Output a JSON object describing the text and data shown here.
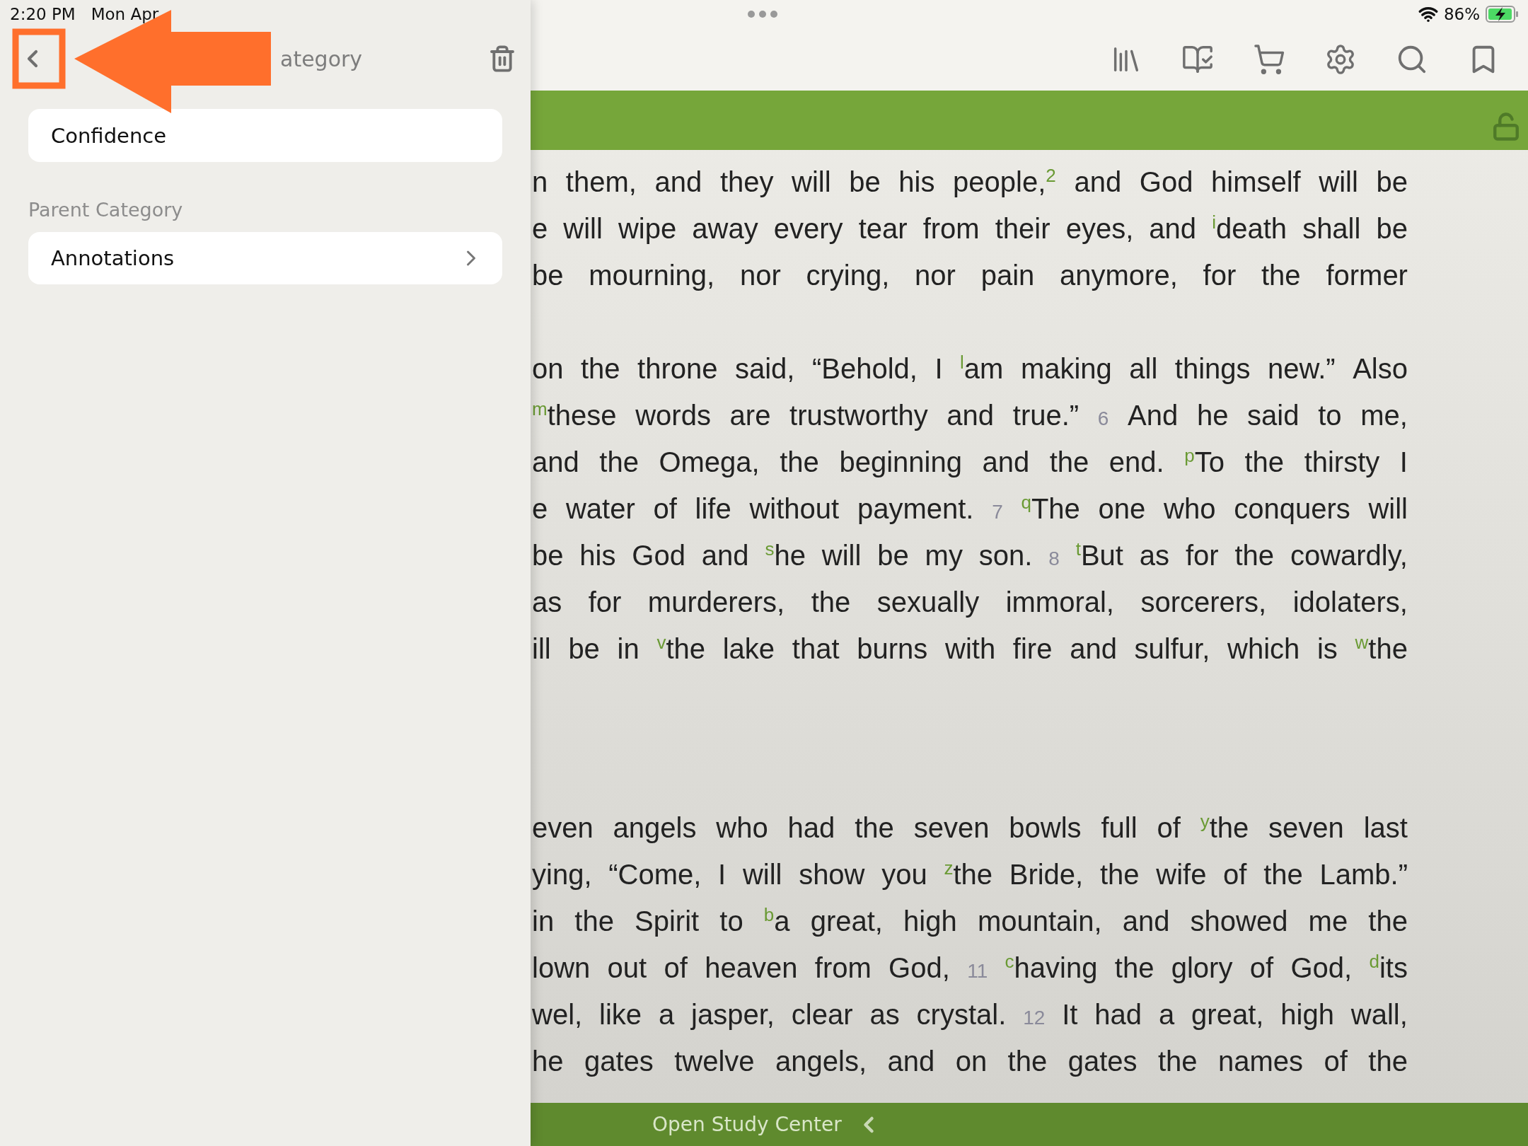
{
  "status_bar": {
    "time": "2:20 PM",
    "date": "Mon Apr",
    "battery": "86%"
  },
  "category_panel": {
    "title": "ategory",
    "name_value": "Confidence",
    "parent_label": "Parent Category",
    "parent_value": "Annotations"
  },
  "reader": {
    "paragraphs": [
      [
        [
          {
            "kind": "text",
            "text": "n them, and they will be his people,"
          },
          {
            "kind": "note",
            "text": "2"
          },
          {
            "kind": "text",
            "text": " and God himself will be"
          }
        ],
        [
          {
            "kind": "text",
            "text": "e will wipe away every tear from their eyes, and "
          },
          {
            "kind": "note",
            "text": "i"
          },
          {
            "kind": "text",
            "text": "death shall be"
          }
        ],
        [
          {
            "kind": "text",
            "text": "be mourning, nor crying, nor pain anymore, for the former"
          }
        ]
      ],
      [
        [
          {
            "kind": "text",
            "text": "on the throne said, “Behold, I "
          },
          {
            "kind": "note",
            "text": "l"
          },
          {
            "kind": "text",
            "text": "am making all things new.” Also"
          }
        ],
        [
          {
            "kind": "note",
            "text": "m"
          },
          {
            "kind": "text",
            "text": "these words are trustworthy and true.” "
          },
          {
            "kind": "verse",
            "text": "6"
          },
          {
            "kind": "text",
            "text": " And he said to me,"
          }
        ],
        [
          {
            "kind": "text",
            "text": "and the Omega, the beginning and the end. "
          },
          {
            "kind": "note",
            "text": "p"
          },
          {
            "kind": "text",
            "text": "To the thirsty I"
          }
        ],
        [
          {
            "kind": "text",
            "text": "e water of life without payment. "
          },
          {
            "kind": "verse",
            "text": "7"
          },
          {
            "kind": "note",
            "text": "q"
          },
          {
            "kind": "text",
            "text": "The one who conquers will"
          }
        ],
        [
          {
            "kind": "text",
            "text": "be his God and "
          },
          {
            "kind": "note",
            "text": "s"
          },
          {
            "kind": "text",
            "text": "he will be my son. "
          },
          {
            "kind": "verse",
            "text": "8"
          },
          {
            "kind": "note",
            "text": "t"
          },
          {
            "kind": "text",
            "text": "But as for the cowardly,"
          }
        ],
        [
          {
            "kind": "text",
            "text": "as for murderers, the sexually immoral, sorcerers, idolaters,"
          }
        ],
        [
          {
            "kind": "text",
            "text": "ill be in "
          },
          {
            "kind": "note",
            "text": "v"
          },
          {
            "kind": "text",
            "text": "the lake that burns with fire and sulfur, which is "
          },
          {
            "kind": "note",
            "text": "w"
          },
          {
            "kind": "text",
            "text": "the"
          }
        ]
      ],
      [
        [
          {
            "kind": "text",
            "text": "even angels who had the seven bowls full of "
          },
          {
            "kind": "note",
            "text": "y"
          },
          {
            "kind": "text",
            "text": "the seven last"
          }
        ],
        [
          {
            "kind": "text",
            "text": "ying, “Come, I will show you "
          },
          {
            "kind": "note",
            "text": "z"
          },
          {
            "kind": "text",
            "text": "the Bride, the wife of the Lamb.”"
          }
        ],
        [
          {
            "kind": "text",
            "text": "in the Spirit to "
          },
          {
            "kind": "note",
            "text": "b"
          },
          {
            "kind": "text",
            "text": "a great, high mountain, and showed me the"
          }
        ],
        [
          {
            "kind": "text",
            "text": "lown out of heaven from God, "
          },
          {
            "kind": "verse",
            "text": "11"
          },
          {
            "kind": "note",
            "text": "c"
          },
          {
            "kind": "text",
            "text": "having the glory of God, "
          },
          {
            "kind": "note",
            "text": "d"
          },
          {
            "kind": "text",
            "text": "its"
          }
        ],
        [
          {
            "kind": "text",
            "text": "wel, like a jasper, clear as crystal. "
          },
          {
            "kind": "verse",
            "text": "12"
          },
          {
            "kind": "text",
            "text": " It had a great, high wall,"
          }
        ],
        [
          {
            "kind": "text",
            "text": "he gates twelve angels, and on the gates the names of the"
          }
        ]
      ]
    ]
  },
  "bottom_bar": {
    "label": "Open Study Center"
  }
}
